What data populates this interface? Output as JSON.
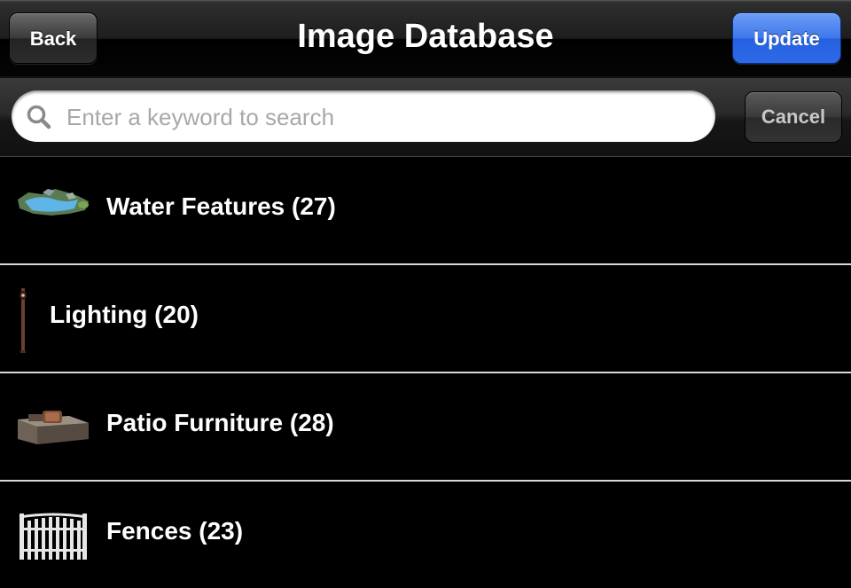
{
  "navbar": {
    "back_label": "Back",
    "title": "Image Database",
    "update_label": "Update",
    "update_color": "#2e6ae8"
  },
  "search": {
    "value": "",
    "placeholder": "Enter a keyword to search",
    "icon": "search-icon",
    "cancel_label": "Cancel"
  },
  "categories": [
    {
      "label": "Water Features (27)",
      "icon": "water-feature-icon"
    },
    {
      "label": "Lighting (20)",
      "icon": "lamp-post-icon"
    },
    {
      "label": "Patio Furniture (28)",
      "icon": "patio-furniture-icon"
    },
    {
      "label": "Fences (23)",
      "icon": "fence-icon"
    }
  ]
}
